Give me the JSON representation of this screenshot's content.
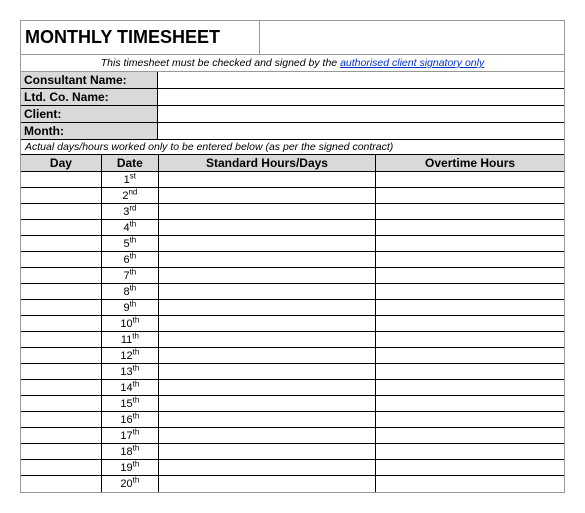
{
  "title": "MONTHLY TIMESHEET",
  "notice_prefix": "This timesheet must be checked and signed by the ",
  "notice_link": "authorised client signatory only",
  "fields": [
    {
      "label": "Consultant Name:",
      "value": " "
    },
    {
      "label": "Ltd. Co. Name:",
      "value": " "
    },
    {
      "label": "Client:",
      "value": " "
    },
    {
      "label": "Month:",
      "value": " "
    }
  ],
  "instruction": "Actual days/hours worked only to be entered below (as per the signed contract)",
  "columns": [
    "Day",
    "Date",
    "Standard Hours/Days",
    "Overtime Hours"
  ],
  "rows": [
    {
      "day": " ",
      "date_num": "1",
      "date_suf": "st",
      "std": " ",
      "ot": " "
    },
    {
      "day": " ",
      "date_num": "2",
      "date_suf": "nd",
      "std": " ",
      "ot": " "
    },
    {
      "day": " ",
      "date_num": "3",
      "date_suf": "rd",
      "std": " ",
      "ot": " "
    },
    {
      "day": " ",
      "date_num": "4",
      "date_suf": "th",
      "std": " ",
      "ot": " "
    },
    {
      "day": " ",
      "date_num": "5",
      "date_suf": "th",
      "std": " ",
      "ot": " "
    },
    {
      "day": " ",
      "date_num": "6",
      "date_suf": "th",
      "std": " ",
      "ot": " "
    },
    {
      "day": " ",
      "date_num": "7",
      "date_suf": "th",
      "std": " ",
      "ot": " "
    },
    {
      "day": " ",
      "date_num": "8",
      "date_suf": "th",
      "std": " ",
      "ot": " "
    },
    {
      "day": " ",
      "date_num": "9",
      "date_suf": "th",
      "std": " ",
      "ot": " "
    },
    {
      "day": " ",
      "date_num": "10",
      "date_suf": "th",
      "std": " ",
      "ot": " "
    },
    {
      "day": " ",
      "date_num": "11",
      "date_suf": "th",
      "std": " ",
      "ot": " "
    },
    {
      "day": " ",
      "date_num": "12",
      "date_suf": "th",
      "std": " ",
      "ot": " "
    },
    {
      "day": " ",
      "date_num": "13",
      "date_suf": "th",
      "std": " ",
      "ot": " "
    },
    {
      "day": " ",
      "date_num": "14",
      "date_suf": "th",
      "std": " ",
      "ot": " "
    },
    {
      "day": " ",
      "date_num": "15",
      "date_suf": "th",
      "std": " ",
      "ot": " "
    },
    {
      "day": " ",
      "date_num": "16",
      "date_suf": "th",
      "std": " ",
      "ot": " "
    },
    {
      "day": " ",
      "date_num": "17",
      "date_suf": "th",
      "std": " ",
      "ot": " "
    },
    {
      "day": " ",
      "date_num": "18",
      "date_suf": "th",
      "std": " ",
      "ot": " "
    },
    {
      "day": " ",
      "date_num": "19",
      "date_suf": "th",
      "std": " ",
      "ot": " "
    },
    {
      "day": " ",
      "date_num": "20",
      "date_suf": "th",
      "std": " ",
      "ot": " "
    }
  ]
}
